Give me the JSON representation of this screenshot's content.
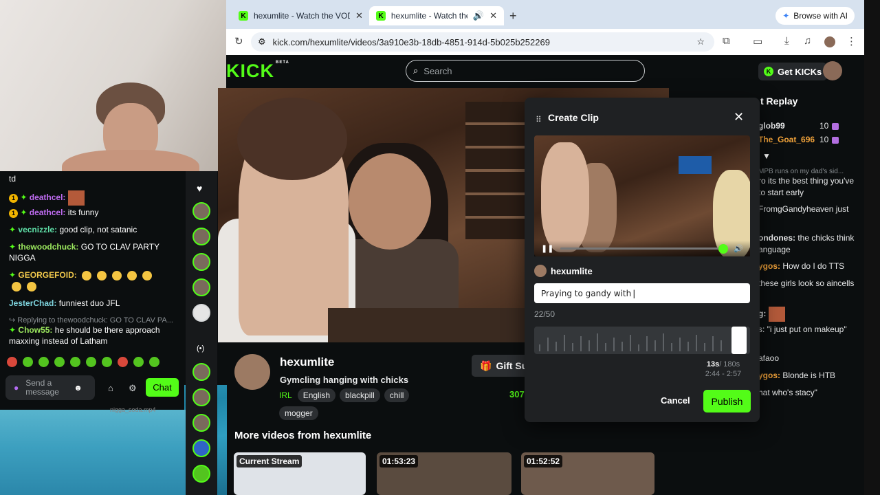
{
  "browser": {
    "tabs": [
      {
        "title": "hexumlite - Watch the VOD o"
      },
      {
        "title": "hexumlite - Watch the VOD"
      }
    ],
    "ai_button": "Browse with AI",
    "url": "kick.com/hexumlite/videos/3a910e3b-18db-4851-914d-5b025b252269"
  },
  "header": {
    "logo": "KICK",
    "logo_badge": "BETA",
    "search_placeholder": "Search",
    "get_kicks": "Get KICKs"
  },
  "left_chat": {
    "lines": [
      {
        "user": "",
        "text": "td"
      },
      {
        "badge": "1",
        "user": "deathcel:",
        "text": ""
      },
      {
        "badge": "1",
        "user": "deathcel:",
        "text": "its funny"
      },
      {
        "user": "vecnizzle:",
        "text": "good clip, not satanic"
      },
      {
        "user": "thewoodchuck:",
        "text": "GO TO CLAV PARTY NIGGA"
      },
      {
        "user": "GEORGEFOID:",
        "text": ""
      },
      {
        "user": "JesterChad:",
        "text": "funniest duo JFL"
      },
      {
        "reply": "Replying to thewoodchuck: GO TO CLAV PA..."
      },
      {
        "user": "Chow55:",
        "text": "he should be there approach maxxing instead of Latham"
      }
    ],
    "send_placeholder": "Send a message",
    "chat_button": "Chat",
    "footer_text": "nigga_soda.mp4"
  },
  "stream": {
    "channel": "hexumlite",
    "title": "Gymcling hanging with chicks",
    "category": "IRL",
    "tags": [
      "English",
      "blackpill",
      "chill",
      "mogger"
    ],
    "gift_button": "Gift Sub",
    "viewers": "307"
  },
  "more_videos": {
    "heading": "More videos from hexumlite",
    "thumbs": [
      {
        "label": "Current Stream"
      },
      {
        "label": "01:53:23"
      },
      {
        "label": "01:52:52"
      }
    ]
  },
  "replay_chat": {
    "heading": "t Replay",
    "lines": [
      {
        "user": "glob99",
        "value": "10"
      },
      {
        "user": "The_Goat_696",
        "value": "10"
      },
      {
        "text": "MPB runs on my dad's sid..."
      },
      {
        "text": "ro its the best thing you've to start early"
      },
      {
        "text": "FromgGandyheaven just"
      },
      {
        "user": "ondones:",
        "text": "the chicks think anguage"
      },
      {
        "user": "ygos:",
        "text": "How do I do TTS"
      },
      {
        "text": "these girls look so aincells"
      },
      {
        "user": "g:",
        "text": ""
      },
      {
        "text": "s: \"i just put on makeup\""
      },
      {
        "text": "afaoo"
      },
      {
        "user": "ygos:",
        "text": "Blonde is HTB"
      },
      {
        "text": "hat who's stacy\""
      }
    ]
  },
  "clip_dialog": {
    "title": "Create Clip",
    "channel": "hexumlite",
    "title_value": "Praying to gandy with",
    "char_count": "22/50",
    "duration": "13s",
    "duration_max": "/ 180s",
    "range": "2:44 - 2:57",
    "cancel": "Cancel",
    "publish": "Publish"
  }
}
